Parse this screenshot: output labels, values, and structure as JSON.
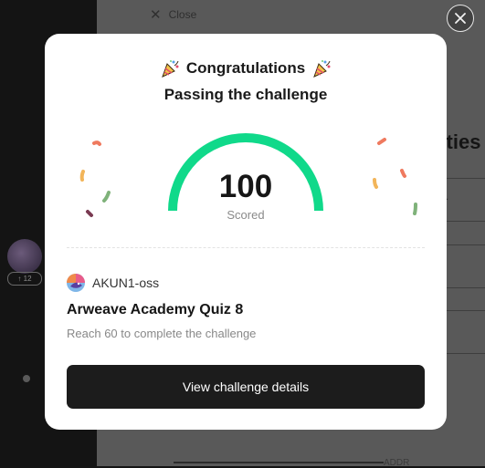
{
  "background": {
    "close_label": "Close",
    "heading_fragment": "rties",
    "badge_text": "12"
  },
  "modal": {
    "title": "Congratulations",
    "subtitle": "Passing the challenge",
    "score": "100",
    "score_label": "Scored",
    "score_fraction": 1.0,
    "author_name": "AKUN1-oss",
    "quiz_title": "Arweave Academy Quiz 8",
    "quiz_description": "Reach 60 to complete the challenge",
    "cta_label": "View challenge details",
    "icons": [
      "party-popper-icon",
      "close-icon",
      "avatar-icon"
    ],
    "colors": {
      "gauge": "#10d98a",
      "button": "#1c1c1c",
      "confetti": [
        "#ef7a5f",
        "#f2b55a",
        "#7fb27a",
        "#7a3a52"
      ]
    }
  }
}
